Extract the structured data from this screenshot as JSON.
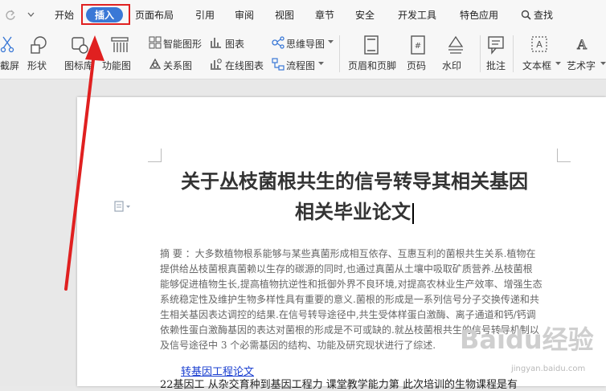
{
  "menubar": {
    "items": [
      {
        "label": "开始"
      },
      {
        "label": "插入"
      },
      {
        "label": "页面布局"
      },
      {
        "label": "引用"
      },
      {
        "label": "审阅"
      },
      {
        "label": "视图"
      },
      {
        "label": "章节"
      },
      {
        "label": "安全"
      },
      {
        "label": "开发工具"
      },
      {
        "label": "特色应用"
      },
      {
        "label": "查找"
      }
    ],
    "active_tab": "插入",
    "accent_color": "#3a78d6",
    "annotation_color": "#e02020"
  },
  "ribbon": {
    "screenshot_partial": "截屏",
    "shape": "形状",
    "icon_lib": "图标库",
    "func_chart": "功能图",
    "smart_art": "智能图形",
    "chart": "图表",
    "mind_map": "思维导图",
    "relation": "关系图",
    "online_chart": "在线图表",
    "flowchart": "流程图",
    "header_footer": "页眉和页脚",
    "page_num": "页码",
    "watermark": "水印",
    "comment": "批注",
    "textbox": "文本框",
    "art_text": "艺术字"
  },
  "document": {
    "title_line1": "关于丛枝菌根共生的信号转导其相关基因",
    "title_line2": "相关毕业论文",
    "abstract_lines": [
      "摘  要 ：大多数植物根系能够与某些真菌形成相互依存、互惠互利的菌根共生关系.植物在",
      "提供给丛枝菌根真菌赖以生存的碳源的同时,也通过真菌从土壤中吸取矿质营养.丛枝菌根",
      "能够促进植物生长,提高植物抗逆性和抵御外界不良环境,对提高农林业生产效率、增强生态",
      "系统稳定性及维护生物多样性具有重要的意义.菌根的形成是一系列信号分子交换传递和共",
      "生相关基因表达调控的结果.在信号转导途径中,共生受体样蛋白激酶、离子通道和钙/钙调",
      "依赖性蛋白激酶基因的表达对菌根的形成是不可或缺的.就丛枝菌根共生的信号转导机制以",
      "及信号途径中 3 个必需基因的结构、功能及研究现状进行了综述."
    ],
    "link": "转基因工程论文",
    "last_line": "22基因工 从杂交育种到基因工程力 课堂教学能力第 此次培训的生物课程是有"
  },
  "watermark": {
    "text": "Baidu经验",
    "url": "jingyan.baidu.com"
  }
}
